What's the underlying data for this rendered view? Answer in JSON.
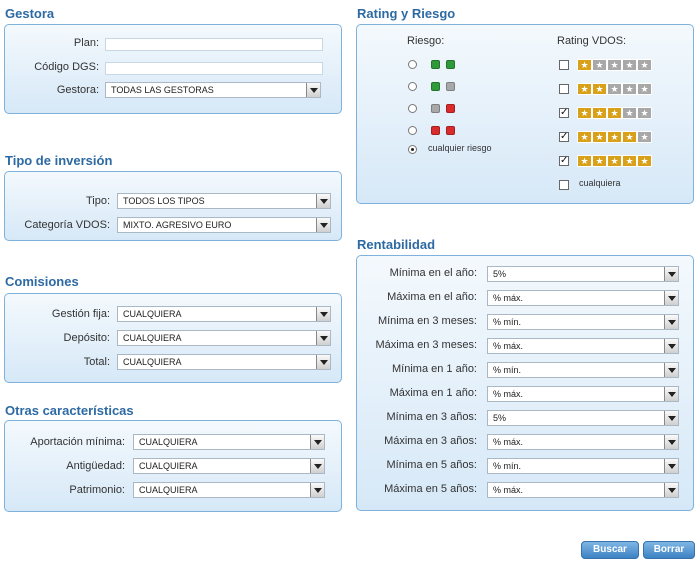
{
  "gestora": {
    "title": "Gestora",
    "plan_label": "Plan:",
    "dgs_label": "Código DGS:",
    "gestora_label": "Gestora:",
    "gestora_value": "TODAS LAS GESTORAS"
  },
  "tipo": {
    "title": "Tipo de inversión",
    "tipo_label": "Tipo:",
    "tipo_value": "TODOS LOS TIPOS",
    "categoria_label": "Categoría VDOS:",
    "categoria_value": "MIXTO. AGRESIVO EURO"
  },
  "comisiones": {
    "title": "Comisiones",
    "fija_label": "Gestión fija:",
    "fija_value": "CUALQUIERA",
    "deposito_label": "Depósito:",
    "deposito_value": "CUALQUIERA",
    "total_label": "Total:",
    "total_value": "CUALQUIERA"
  },
  "otras": {
    "title": "Otras características",
    "aportacion_label": "Aportación mínima:",
    "aportacion_value": "CUALQUIERA",
    "antiguedad_label": "Antigüedad:",
    "antiguedad_value": "CUALQUIERA",
    "patrimonio_label": "Patrimonio:",
    "patrimonio_value": "CUALQUIERA"
  },
  "rating": {
    "title": "Rating y Riesgo",
    "riesgo_label": "Riesgo:",
    "rating_label": "Rating VDOS:",
    "cualquier_riesgo": "cualquier riesgo",
    "cualquiera": "cualquiera",
    "risk_colors": [
      [
        "#2f9a3a",
        "#2f9a3a"
      ],
      [
        "#2f9a3a",
        "#a8a8a8"
      ],
      [
        "#a8a8a8",
        "#d92b2b"
      ],
      [
        "#d92b2b",
        "#d92b2b"
      ]
    ],
    "rating_checked": [
      false,
      false,
      true,
      true,
      true
    ],
    "gold": "#d9a11a",
    "grey": "#a8a8a8"
  },
  "rent": {
    "title": "Rentabilidad",
    "rows": [
      {
        "label": "Mínima en el año:",
        "value": "5%"
      },
      {
        "label": "Máxima en el año:",
        "value": "% máx."
      },
      {
        "label": "Mínima en 3 meses:",
        "value": "% mín."
      },
      {
        "label": "Máxima en 3 meses:",
        "value": "% máx."
      },
      {
        "label": "Mínima en 1 año:",
        "value": "% mín."
      },
      {
        "label": "Máxima en 1 año:",
        "value": "% máx."
      },
      {
        "label": "Mínima en 3 años:",
        "value": "5%"
      },
      {
        "label": "Máxima en 3 años:",
        "value": "% máx."
      },
      {
        "label": "Mínima en 5 años:",
        "value": "% mín."
      },
      {
        "label": "Máxima en 5 años:",
        "value": "% máx."
      }
    ]
  },
  "buttons": {
    "buscar": "Buscar",
    "borrar": "Borrar"
  }
}
